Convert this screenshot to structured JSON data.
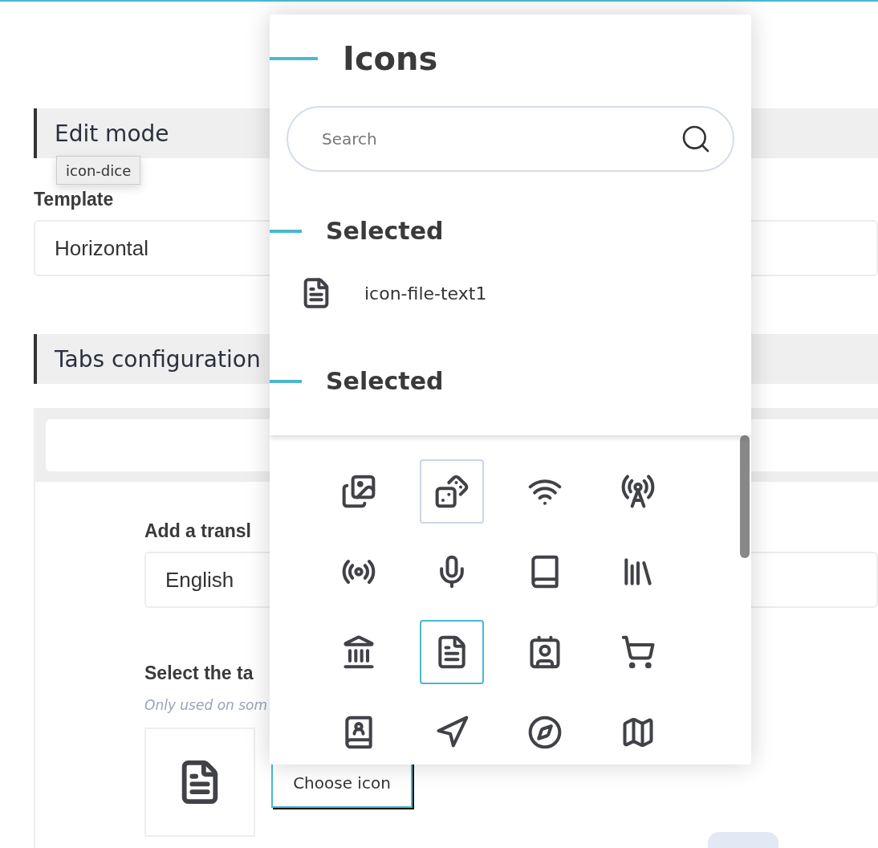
{
  "page": {
    "edit_mode_title": "Edit mode",
    "template_label": "Template",
    "template_value": "Horizontal",
    "tabs_title": "Tabs configuration",
    "translation_label": "Add a transl",
    "language_value": "English",
    "tab_icon_label": "Select the ta",
    "tab_icon_hint": "Only used on som",
    "choose_icon_button": "Choose icon"
  },
  "tooltip": "icon-dice",
  "icon_picker": {
    "title": "Icons",
    "search": {
      "placeholder": "Search"
    },
    "selected_heading": "Selected",
    "selected_item": "icon-file-text1",
    "grid_heading": "Selected",
    "grid": [
      {
        "selected": false,
        "hovered": false
      },
      {
        "selected": false,
        "hovered": true
      },
      {
        "selected": false,
        "hovered": false
      },
      {
        "selected": false,
        "hovered": false
      },
      {
        "selected": false,
        "hovered": false
      },
      {
        "selected": false,
        "hovered": false
      },
      {
        "selected": false,
        "hovered": false
      },
      {
        "selected": false,
        "hovered": false
      },
      {
        "selected": false,
        "hovered": false
      },
      {
        "selected": true,
        "hovered": false
      },
      {
        "selected": false,
        "hovered": false
      },
      {
        "selected": false,
        "hovered": false
      },
      {
        "selected": false,
        "hovered": false
      },
      {
        "selected": false,
        "hovered": false
      },
      {
        "selected": false,
        "hovered": false
      },
      {
        "selected": false,
        "hovered": false
      }
    ]
  }
}
